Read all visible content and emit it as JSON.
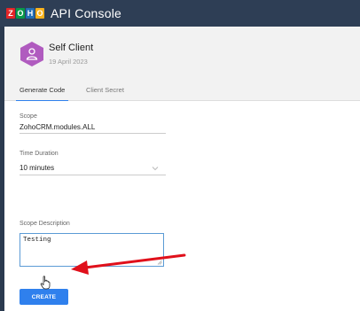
{
  "topbar": {
    "logo_letters": [
      "Z",
      "O",
      "H",
      "O"
    ],
    "title": "API Console"
  },
  "client": {
    "name": "Self Client",
    "date": "19 April 2023",
    "avatar_icon": "user-icon",
    "avatar_color": "#b05bbf"
  },
  "tabs": [
    {
      "label": "Generate Code",
      "active": true
    },
    {
      "label": "Client Secret",
      "active": false
    }
  ],
  "form": {
    "scope_label": "Scope",
    "scope_value": "ZohoCRM.modules.ALL",
    "duration_label": "Time Duration",
    "duration_value": "10 minutes",
    "description_label": "Scope Description",
    "description_value": "Testing",
    "create_label": "CREATE"
  },
  "colors": {
    "accent": "#2f80ed",
    "arrow": "#e0101b",
    "topbar": "#2e3e55"
  }
}
